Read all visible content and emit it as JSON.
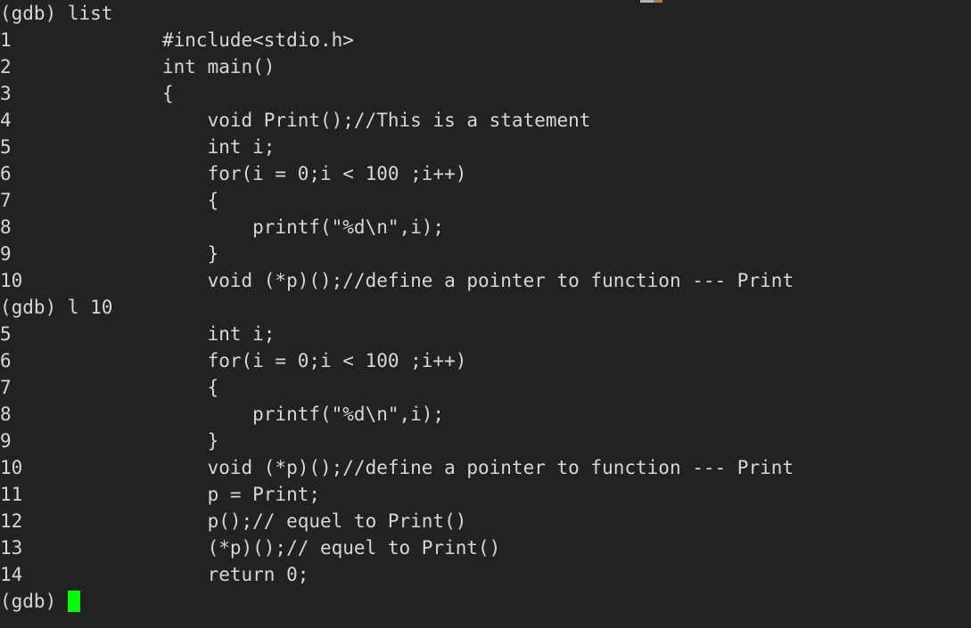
{
  "terminal": {
    "background_color": "#222222",
    "text_color": "#d8d8d2",
    "cursor_color": "#00ff00",
    "blocks": [
      {
        "prompt": "(gdb) list",
        "listing": [
          {
            "lineno": "1",
            "code": "#include<stdio.h>"
          },
          {
            "lineno": "2",
            "code": "int main()"
          },
          {
            "lineno": "3",
            "code": "{"
          },
          {
            "lineno": "4",
            "code": "    void Print();//This is a statement"
          },
          {
            "lineno": "5",
            "code": "    int i;"
          },
          {
            "lineno": "6",
            "code": "    for(i = 0;i < 100 ;i++)"
          },
          {
            "lineno": "7",
            "code": "    {"
          },
          {
            "lineno": "8",
            "code": "        printf(\"%d\\n\",i);"
          },
          {
            "lineno": "9",
            "code": "    }"
          },
          {
            "lineno": "10",
            "code": "    void (*p)();//define a pointer to function --- Print"
          }
        ]
      },
      {
        "prompt": "(gdb) l 10",
        "listing": [
          {
            "lineno": "5",
            "code": "    int i;"
          },
          {
            "lineno": "6",
            "code": "    for(i = 0;i < 100 ;i++)"
          },
          {
            "lineno": "7",
            "code": "    {"
          },
          {
            "lineno": "8",
            "code": "        printf(\"%d\\n\",i);"
          },
          {
            "lineno": "9",
            "code": "    }"
          },
          {
            "lineno": "10",
            "code": "    void (*p)();//define a pointer to function --- Print"
          },
          {
            "lineno": "11",
            "code": "    p = Print;"
          },
          {
            "lineno": "12",
            "code": "    p();// equel to Print()"
          },
          {
            "lineno": "13",
            "code": "    (*p)();// equel to Print()"
          },
          {
            "lineno": "14",
            "code": "    return 0;"
          }
        ]
      }
    ],
    "final_prompt": "(gdb) "
  }
}
